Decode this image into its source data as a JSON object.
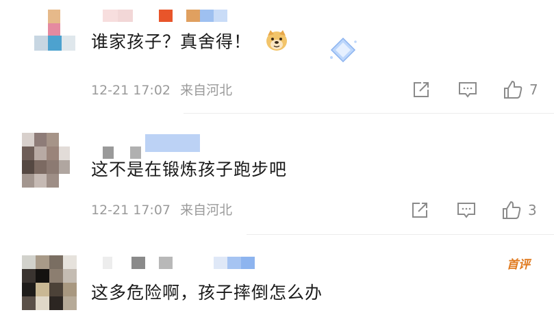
{
  "comments": [
    {
      "text": "谁家孩子？真舍得！",
      "time": "12-21 17:02",
      "location": "来自河北",
      "likes": "7",
      "emoji": "doge-emoji"
    },
    {
      "text": "这不是在锻炼孩子跑步吧",
      "time": "12-21 17:07",
      "location": "来自河北",
      "likes": "3"
    },
    {
      "text": "这多危险啊，孩子摔倒怎么办",
      "badge": "首评"
    }
  ],
  "icons": {
    "share": "share-icon",
    "reply": "comment-icon",
    "like": "thumbs-up-icon"
  }
}
